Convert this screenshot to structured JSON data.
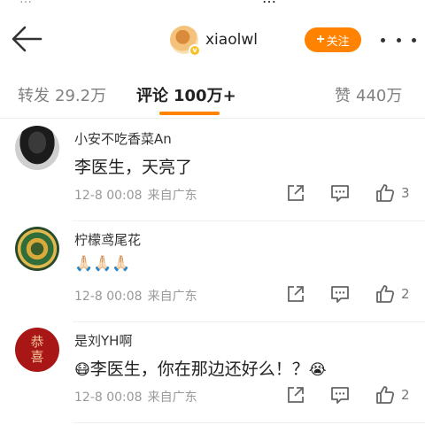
{
  "status": {
    "left": "…",
    "mid": "…"
  },
  "header": {
    "username": "xiaolwl",
    "follow_plus": "+",
    "follow_label": "关注",
    "verified_mark": "v"
  },
  "tabs": [
    {
      "label": "转发",
      "count": "29.2万"
    },
    {
      "label": "评论",
      "count": "100万+"
    },
    {
      "label": "赞",
      "count": "440万"
    }
  ],
  "colors": {
    "accent": "#ff8200",
    "text": "#222222",
    "meta": "#999999"
  },
  "icons": [
    "back-arrow-icon",
    "more-dots-icon",
    "share-icon",
    "reply-icon",
    "like-icon",
    "pray-hands-emoji",
    "mask-face-emoji",
    "crying-face-emoji"
  ],
  "comments": [
    {
      "name": "小安不吃香菜An",
      "text": "李医生，天亮了",
      "time": "12-8 00:08",
      "source": "来自广东",
      "likes": "3"
    },
    {
      "name": "柠檬鸢尾花",
      "text": "🙏🏻🙏🏻🙏🏻",
      "time": "12-8 00:08",
      "source": "来自广东",
      "likes": "2"
    },
    {
      "name": "是刘YH啊",
      "prefix_emoji": "😷",
      "text": "李医生，你在那边还好么！？",
      "suffix_emoji": "😭",
      "time": "12-8 00:08",
      "source": "来自广东",
      "likes": "2",
      "avatar_text_1": "恭",
      "avatar_text_2": "喜"
    }
  ]
}
